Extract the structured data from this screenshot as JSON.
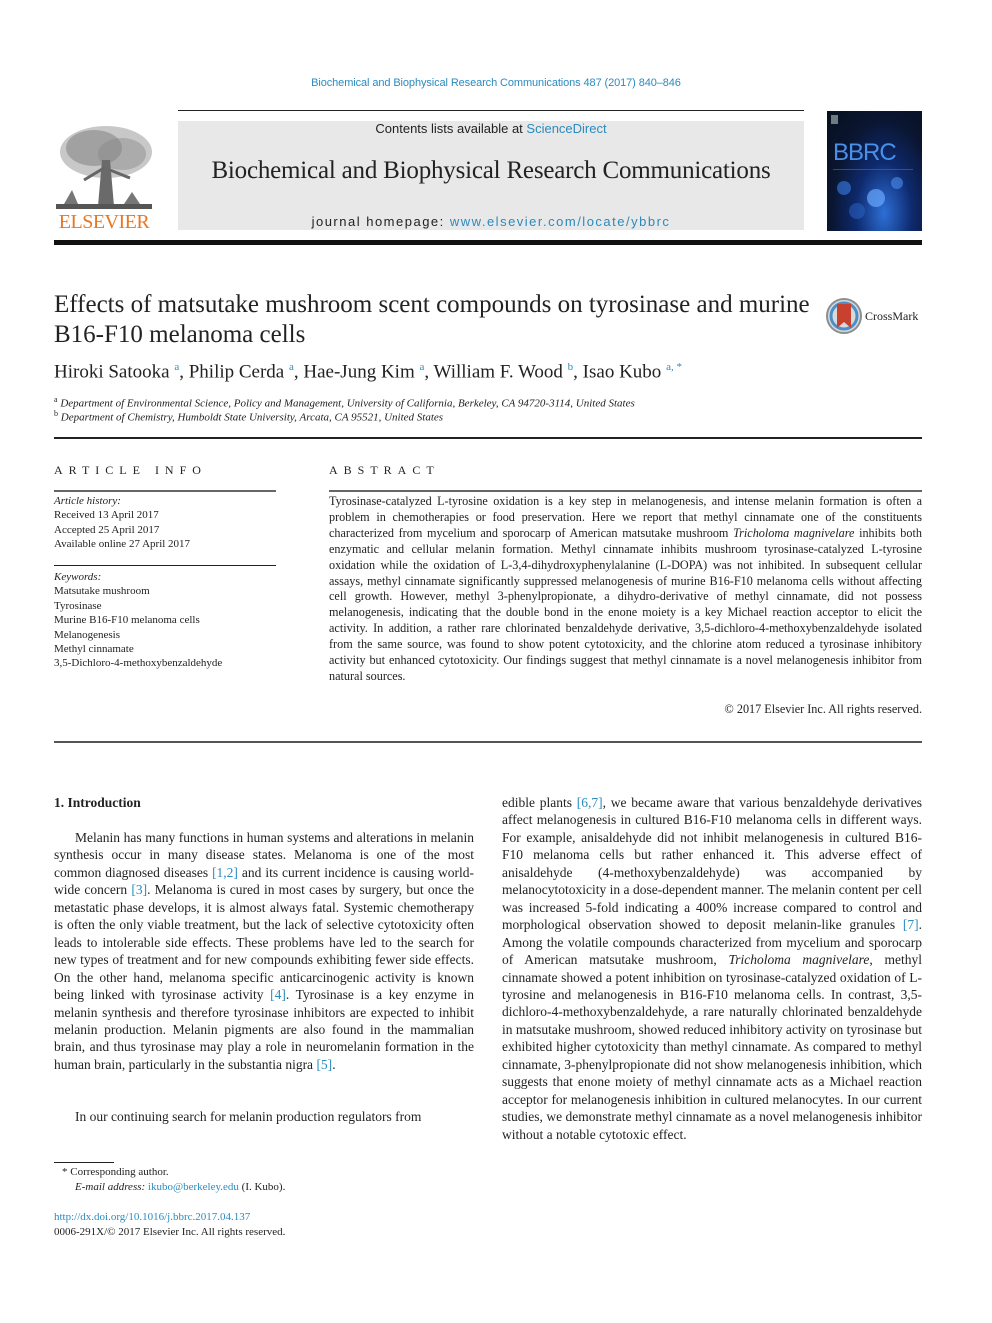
{
  "header": {
    "citation": "Biochemical and Biophysical Research Communications 487 (2017) 840–846",
    "contents_prefix": "Contents lists available at ",
    "contents_link": "ScienceDirect",
    "journal_title": "Biochemical and Biophysical Research Communications",
    "homepage_prefix": "journal homepage: ",
    "homepage_link": "www.elsevier.com/locate/ybbrc",
    "publisher_logo_text": "ELSEVIER",
    "cover_title": "BBRC",
    "publisher_color": "#e87722",
    "link_color": "#2a8bbf"
  },
  "article": {
    "title": "Effects of matsutake mushroom scent compounds on tyrosinase and murine B16-F10 melanoma cells",
    "crossmark_label": "CrossMark",
    "authors": [
      {
        "name": "Hiroki Satooka",
        "sup": "a"
      },
      {
        "name": "Philip Cerda",
        "sup": "a"
      },
      {
        "name": "Hae-Jung Kim",
        "sup": "a"
      },
      {
        "name": "William F. Wood",
        "sup": "b"
      },
      {
        "name": "Isao Kubo",
        "sup": "a, *"
      }
    ],
    "affiliations": [
      {
        "sup": "a",
        "text": "Department of Environmental Science, Policy and Management, University of California, Berkeley, CA 94720-3114, United States"
      },
      {
        "sup": "b",
        "text": "Department of Chemistry, Humboldt State University, Arcata, CA 95521, United States"
      }
    ]
  },
  "article_info": {
    "heading": "ARTICLE INFO",
    "history_label": "Article history:",
    "history": [
      "Received 13 April 2017",
      "Accepted 25 April 2017",
      "Available online 27 April 2017"
    ],
    "keywords_label": "Keywords:",
    "keywords": [
      "Matsutake mushroom",
      "Tyrosinase",
      "Murine B16-F10 melanoma cells",
      "Melanogenesis",
      "Methyl cinnamate",
      "3,5-Dichloro-4-methoxybenzaldehyde"
    ]
  },
  "abstract": {
    "heading": "ABSTRACT",
    "p1": "Tyrosinase-catalyzed ",
    "p2": "-tyrosine oxidation is a key step in melanogenesis, and intense melanin formation is often a problem in chemotherapies or food preservation. Here we report that methyl cinnamate one of the constituents characterized from mycelium and sporocarp of American matsutake mushroom ",
    "species": "Tricholoma magnivelare",
    "p3": " inhibits both enzymatic and cellular melanin formation. Methyl cinnamate inhibits mushroom tyrosinase-catalyzed ",
    "p4": "-tyrosine oxidation while the oxidation of ",
    "p5": "-3,4-dihydroxyphenylalanine (",
    "p6": "-DOPA) was not inhibited. In subsequent cellular assays, methyl cinnamate significantly suppressed melanogenesis of murine B16-F10 melanoma cells without affecting cell growth. However, methyl 3-phenylpropionate, a dihydro-derivative of methyl cinnamate, did not possess melanogenesis, indicating that the double bond in the enone moiety is a key Michael reaction acceptor to elicit the activity. In addition, a rather rare chlorinated benzaldehyde derivative, 3,5-dichloro-4-methoxybenzaldehyde isolated from the same source, was found to show potent cytotoxicity, and the chlorine atom reduced a tyrosinase inhibitory activity but enhanced cytotoxicity. Our findings suggest that methyl cinnamate is a novel melanogenesis inhibitor from natural sources.",
    "L": "L",
    "copyright": "© 2017 Elsevier Inc. All rights reserved."
  },
  "introduction": {
    "heading": "1.  Introduction",
    "left_p1_a": "Melanin has many functions in human systems and alterations in melanin synthesis occur in many disease states. Melanoma is one of the most common diagnosed diseases ",
    "ref_1_2": "[1,2]",
    "left_p1_b": " and its current incidence is causing world-wide concern ",
    "ref_3": "[3]",
    "left_p1_c": ". Melanoma is cured in most cases by surgery, but once the metastatic phase develops, it is almost always fatal. Systemic chemotherapy is often the only viable treatment, but the lack of selective cytotoxicity often leads to intolerable side effects. These problems have led to the search for new types of treatment and for new compounds exhibiting fewer side effects. On the other hand, melanoma specific anticarcinogenic activity is known being linked with tyrosinase activity ",
    "ref_4": "[4]",
    "left_p1_d": ". Tyrosinase is a key enzyme in melanin synthesis and therefore tyrosinase inhibitors are expected to inhibit melanin production. Melanin pigments are also found in the mammalian brain, and thus tyrosinase may play a role in neuromelanin formation in the human brain, particularly in the substantia nigra ",
    "ref_5": "[5]",
    "left_p1_e": ".",
    "left_p2": "In our continuing search for melanin production regulators from",
    "right_a": "edible plants ",
    "ref_6_7": "[6,7]",
    "right_b": ", we became aware that various benzaldehyde derivatives affect melanogenesis in cultured B16-F10 melanoma cells in different ways. For example, anisaldehyde did not inhibit melanogenesis in cultured B16-F10 melanoma cells but rather enhanced it. This adverse effect of anisaldehyde (4-methoxybenzaldehyde) was accompanied by melanocytotoxicity in a dose-dependent manner. The melanin content per cell was increased 5-fold indicating a 400% increase compared to control and morphological observation showed to deposit melanin-like granules ",
    "ref_7": "[7]",
    "right_c": ". Among the volatile compounds characterized from mycelium and sporocarp of American matsutake mushroom, ",
    "right_species": "Tricholoma magnivelare",
    "right_d": ", methyl cinnamate showed a potent inhibition on tyrosinase-catalyzed oxidation of ",
    "right_e": "-tyrosine and melanogenesis in B16-F10 melanoma cells. In contrast, 3,5-dichloro-4-methoxybenzaldehyde, a rare naturally chlorinated benzaldehyde in matsutake mushroom, showed reduced inhibitory activity on tyrosinase but exhibited higher cytotoxicity than methyl cinnamate. As compared to methyl cinnamate, 3-phenylpropionate did not show melanogenesis inhibition, which suggests that enone moiety of methyl cinnamate acts as a Michael reaction acceptor for melanogenesis inhibition in cultured melanocytes. In our current studies, we demonstrate methyl cinnamate as a novel melanogenesis inhibitor without a notable cytotoxic effect."
  },
  "footnotes": {
    "corresponding": "* Corresponding author.",
    "email_label": "E-mail address: ",
    "email": "ikubo@berkeley.edu",
    "email_suffix": " (I. Kubo).",
    "doi": "http://dx.doi.org/10.1016/j.bbrc.2017.04.137",
    "issn": "0006-291X/© 2017 Elsevier Inc. All rights reserved."
  }
}
